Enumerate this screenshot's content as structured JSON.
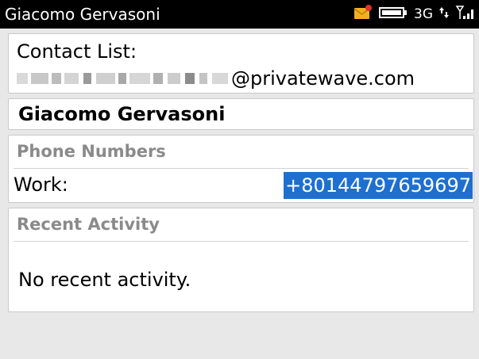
{
  "status_bar": {
    "title": "Giacomo Gervasoni",
    "network": "3G",
    "icons": [
      "message-notification-icon",
      "battery-icon",
      "data-transfer-icon",
      "signal-strength-icon"
    ],
    "colors": {
      "background": "#000000",
      "envelope": "#f2b01e",
      "notification_dot": "#e0332b"
    }
  },
  "contact": {
    "list_label": "Contact List:",
    "email_domain": "@privatewave.com",
    "name": "Giacomo Gervasoni"
  },
  "phone_section": {
    "header": "Phone Numbers",
    "entries": [
      {
        "type_label": "Work:",
        "number": "+80144797659697"
      }
    ],
    "selection_color": "#1e6fd0"
  },
  "activity_section": {
    "header": "Recent Activity",
    "empty_text": "No recent activity."
  }
}
